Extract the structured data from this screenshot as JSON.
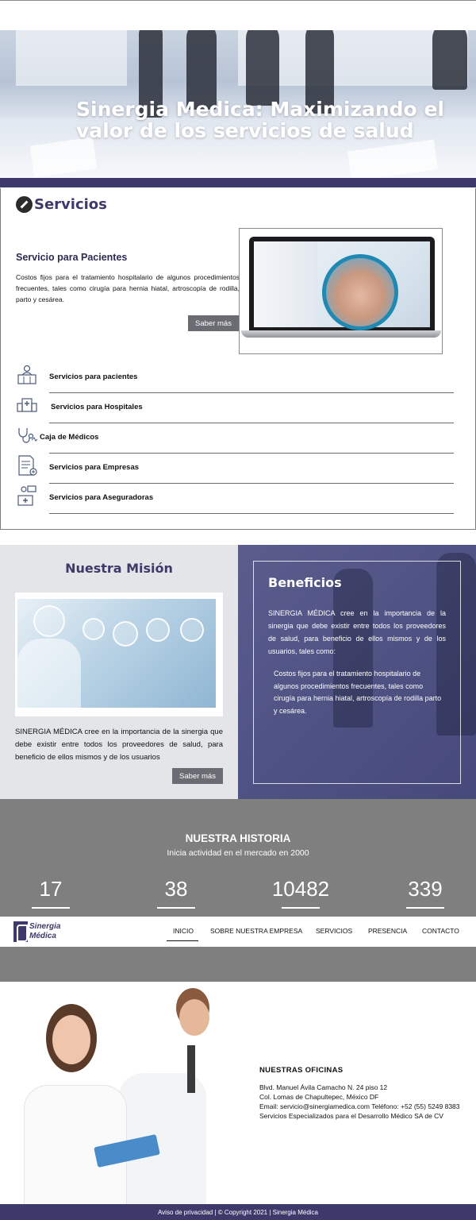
{
  "hero": {
    "title": "Sinergia Medica: Maximizando el valor de los servicios de salud"
  },
  "servicios": {
    "title": "Servicios",
    "featured": {
      "title": "Servicio para Pacientes",
      "text": "Costos fijos para el tratamiento hospitalario de algunos procedimientos frecuentes, tales como cirugía para hernia hiatal, artroscopía de rodilla, parto y cesárea.",
      "button": "Saber más"
    },
    "items": [
      {
        "label": "Servicios para pacientes",
        "icon": "reception-icon"
      },
      {
        "label": "Servicios para Hospitales",
        "icon": "hospital-icon"
      },
      {
        "label": "Caja de Médicos",
        "icon": "stethoscope-icon"
      },
      {
        "label": "Servicios para Empresas",
        "icon": "document-icon"
      },
      {
        "label": "Servicios para Aseguradoras",
        "icon": "insurance-icon"
      }
    ]
  },
  "mision": {
    "title": "Nuestra Misión",
    "text": "SINERGIA MÉDICA cree en la importancia de la sinergia que debe existir entre todos los proveedores de salud, para beneficio de ellos mismos y de los usuarios",
    "button": "Saber más"
  },
  "beneficios": {
    "title": "Beneficios",
    "text": "SINERGIA MÉDICA cree en la importancia de la sinergia que debe existir entre todos los proveedores de salud, para beneficio de ellos mismos y de los usuarios, tales como:",
    "item": "Costos fijos para el tratamiento hospitalario de algunos procedimientos frecuentes, tales como cirugía para hernia hiatal, artroscopía de rodilla parto y cesárea."
  },
  "historia": {
    "title": "NUESTRA HISTORIA",
    "subtitle": "Inicia actividad en el mercado en 2000",
    "stats": [
      "17",
      "38",
      "10482",
      "339"
    ]
  },
  "nav": {
    "logo_line1": "Sinergia",
    "logo_line2": "Médica",
    "items": [
      "INICIO",
      "SOBRE NUESTRA EMPRESA",
      "SERVICIOS",
      "PRESENCIA",
      "CONTACTO"
    ]
  },
  "oficinas": {
    "title": "NUESTRAS OFICINAS",
    "lines": [
      "Blvd. Manuel Ávila Camacho N. 24 piso 12",
      "Col. Lomas de Chapultepec, México DF",
      "Email: servicio@sinergiamedica.com Teléfono: +52 (55) 5249 8383",
      "Servicios Especializados para el Desarrollo Médico SA de CV"
    ]
  },
  "footer": {
    "text": "Aviso de privacidad | © Copyright 2021 | Sinergia Médica"
  },
  "colors": {
    "brand": "#3d3a6b",
    "grey_band": "#7f7f7f",
    "button": "#6b6b73"
  }
}
